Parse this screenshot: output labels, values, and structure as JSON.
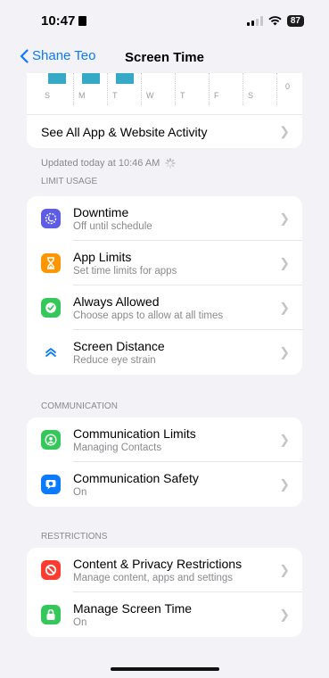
{
  "status": {
    "time": "10:47",
    "battery": "87"
  },
  "nav": {
    "back_label": "Shane Teo",
    "title": "Screen Time"
  },
  "chart": {
    "days": [
      "S",
      "M",
      "T",
      "W",
      "T",
      "F",
      "S"
    ],
    "axis_label": "0"
  },
  "chart_data": {
    "type": "bar",
    "categories": [
      "S",
      "M",
      "T",
      "W",
      "T",
      "F",
      "S"
    ],
    "ylabel": "",
    "y_tick": "0"
  },
  "activity": {
    "see_all_label": "See All App & Website Activity",
    "updated": "Updated today at 10:46 AM"
  },
  "sections": {
    "limit_usage": {
      "header": "LIMIT USAGE",
      "items": [
        {
          "title": "Downtime",
          "subtitle": "Off until schedule",
          "icon": "downtime-icon",
          "color": "#5e5ce6"
        },
        {
          "title": "App Limits",
          "subtitle": "Set time limits for apps",
          "icon": "hourglass-icon",
          "color": "#ff9500"
        },
        {
          "title": "Always Allowed",
          "subtitle": "Choose apps to allow at all times",
          "icon": "checkmark-icon",
          "color": "#34c759"
        },
        {
          "title": "Screen Distance",
          "subtitle": "Reduce eye strain",
          "icon": "chevrons-up-icon",
          "color": "#0a7aff"
        }
      ]
    },
    "communication": {
      "header": "COMMUNICATION",
      "items": [
        {
          "title": "Communication Limits",
          "subtitle": "Managing Contacts",
          "icon": "contact-icon",
          "color": "#34c759"
        },
        {
          "title": "Communication Safety",
          "subtitle": "On",
          "icon": "chat-shield-icon",
          "color": "#0a7aff"
        }
      ]
    },
    "restrictions": {
      "header": "RESTRICTIONS",
      "items": [
        {
          "title": "Content & Privacy Restrictions",
          "subtitle": "Manage content, apps and settings",
          "icon": "no-entry-icon",
          "color": "#ff3b30"
        },
        {
          "title": "Manage Screen Time",
          "subtitle": "On",
          "icon": "lock-icon",
          "color": "#34c759"
        }
      ]
    }
  }
}
